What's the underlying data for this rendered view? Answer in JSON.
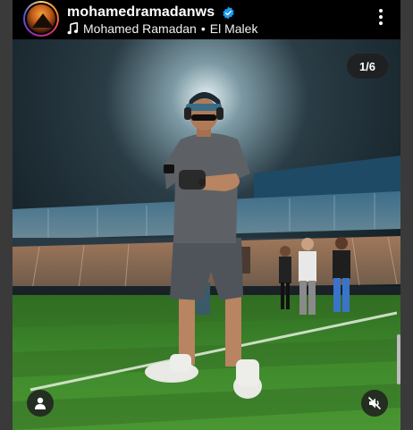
{
  "post": {
    "username": "mohamedramadanws",
    "verified": true,
    "audio_artist": "Mohamed Ramadan",
    "audio_separator": "•",
    "audio_track": "El Malek",
    "audio_icon": "music-note-icon",
    "more_icon": "more-vertical-icon"
  },
  "media": {
    "counter": "1/6",
    "tag_icon": "user-tag-icon",
    "mute_icon": "speaker-muted-icon"
  },
  "colors": {
    "background": "#000000",
    "verified_badge": "#1d9bf0",
    "pitch_green": "#3f8a2c",
    "frame_gray": "#3a3a3a"
  }
}
